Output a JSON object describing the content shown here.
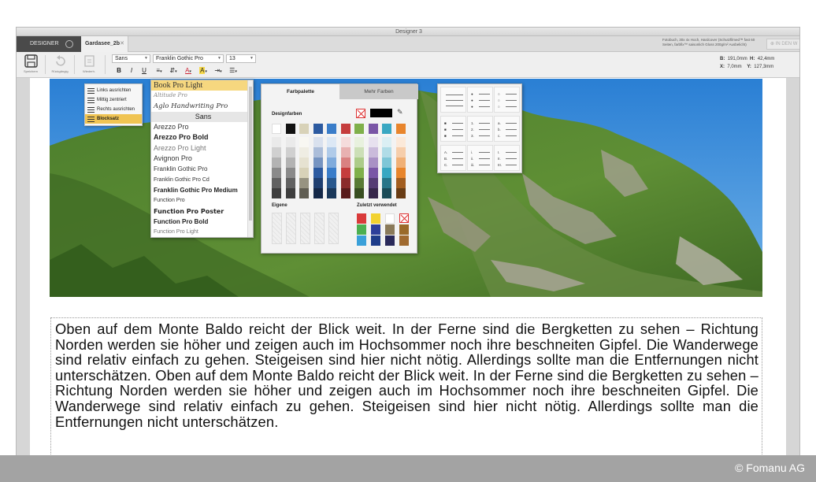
{
  "window": {
    "title": "Designer 3"
  },
  "tabs": {
    "designer": "DESIGNER",
    "document": "Gardasee_2b",
    "document_close": "✕",
    "info": "Fotobuch, 30x 4x Hoch, Hardcover (Schutzfilmed™ fast 60 Seiten, farbfix™ saisonlich Gloss 200g/m² Ausbelicht)",
    "cart_button": "IN DEN W"
  },
  "toolbar": {
    "save_label": "Speichern",
    "undo_label": "Rückgängig",
    "redo_label": "Wiederh.",
    "style_value": "Sans",
    "font_value": "Franklin Gothic Pro",
    "size_value": "13",
    "bold": "B",
    "italic": "I",
    "underline": "U",
    "align_icon": "≡",
    "valign_icon": "⇵",
    "color_icon": "A",
    "highlight_icon": "A",
    "indent_icon": "⇥",
    "list_icon": "☰",
    "coords": {
      "b_label": "B:",
      "b_value": "191,0mm",
      "h_label": "H:",
      "h_value": "42,4mm",
      "x_label": "X:",
      "x_value": "7,0mm",
      "y_label": "Y:",
      "y_value": "127,3mm"
    }
  },
  "align_menu": [
    "Links ausrichten",
    "Mittig zentriert",
    "Rechts ausrichten",
    "Blocksatz"
  ],
  "font_list": [
    "Book Pro Light",
    "Altitude Pro",
    "Aglo Handwriting Pro",
    "Sans",
    "Arezzo Pro",
    "Arezzo Pro Bold",
    "Arezzo Pro Light",
    "Avignon Pro",
    "Franklin Gothic Pro",
    "Franklin Gothic Pro Cd",
    "Franklin Gothic Pro Medium",
    "Function Pro",
    "Function Pro Poster",
    "Function Pro Bold",
    "Function Pro Light"
  ],
  "color_palette": {
    "tab_palette": "Farbpalette",
    "tab_more": "Mehr Farben",
    "design_colors": "Designfarben",
    "own": "Eigene",
    "recent": "Zuletzt verwendet",
    "columns": [
      "#ffffff",
      "#111111",
      "#d8d2b8",
      "#2c5aa0",
      "#3a7dc9",
      "#c53d3d",
      "#7fb04a",
      "#7a56a6",
      "#39a7c2",
      "#e8852c"
    ],
    "recent_colors": [
      "#d93a3a",
      "#f2d230",
      "#ffffff",
      "#ffffff",
      "#4caf50",
      "#2d3f9a",
      "#8a7a5a",
      "#9a6a2a",
      "#3aa0d9",
      "#1e3c8a",
      "#2a2a5a",
      "#a06a30"
    ]
  },
  "list_styles": {
    "numbered": [
      "1.",
      "2.",
      "3."
    ],
    "letters": [
      "a.",
      "b.",
      "c."
    ],
    "caps": [
      "A.",
      "B.",
      "C."
    ],
    "roman_small": [
      "i.",
      "ii.",
      "iii."
    ],
    "roman_caps": [
      "I.",
      "II.",
      "III."
    ]
  },
  "body_text": "Oben auf dem Monte Baldo reicht der Blick weit. In der Ferne sind die Bergketten zu sehen – Richtung Norden werden sie höher und zeigen auch im Hochsommer noch ihre beschneiten Gipfel. Die Wanderwege sind relativ einfach zu gehen. Steigeisen sind hier nicht nötig. Allerdings sollte man die Entfernungen nicht unterschätzen. Oben auf dem Monte Baldo reicht der Blick weit. In der Ferne sind die Bergketten zu sehen – Richtung Norden werden sie höher und zeigen auch im Hochsommer noch ihre beschneiten Gipfel. Die Wanderwege sind relativ einfach zu gehen. Steigeisen sind hier nicht nötig. Allerdings sollte man die Entfernungen nicht unterschätzen.",
  "caption": "© Fomanu AG"
}
